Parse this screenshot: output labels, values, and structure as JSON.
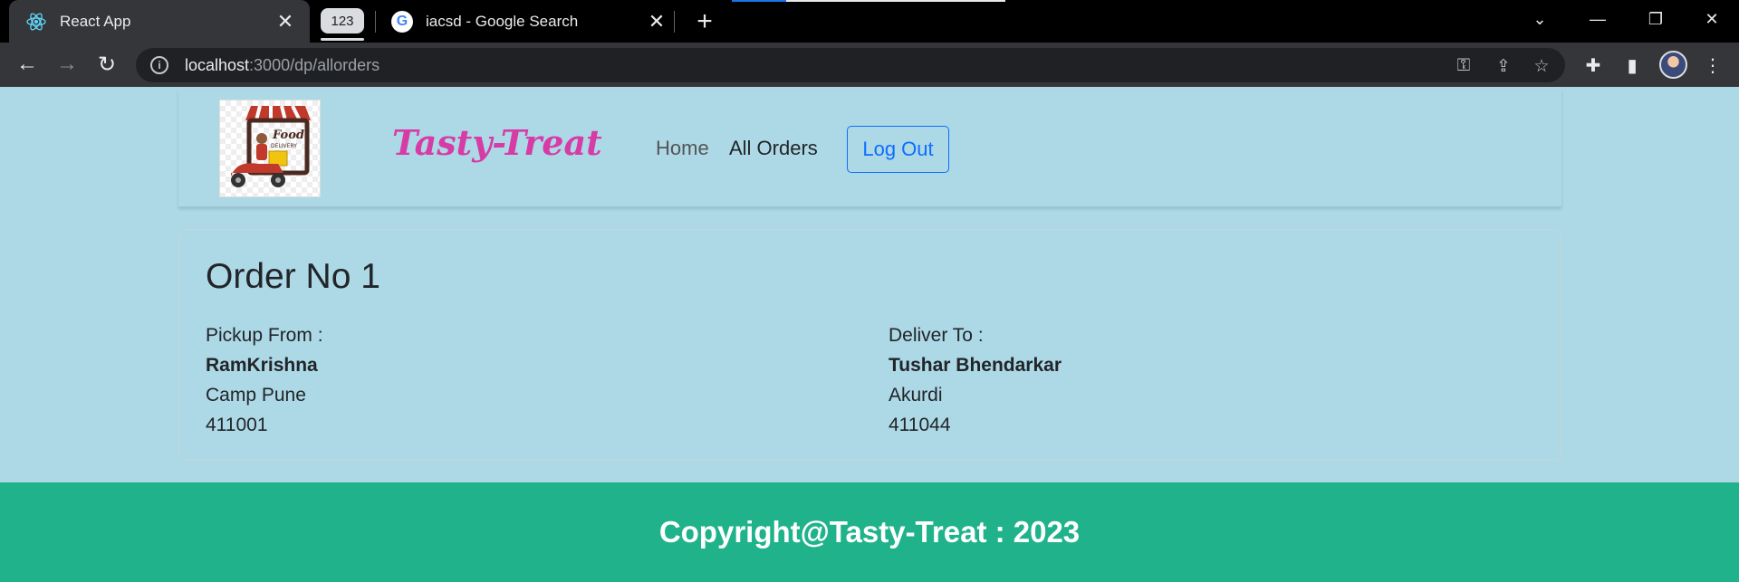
{
  "browser": {
    "tabs": [
      {
        "title": "React App",
        "favicon": "react-icon",
        "active": true
      },
      {
        "title": "iacsd - Google Search",
        "favicon": "google-icon",
        "active": false
      }
    ],
    "tab_group_label": "123",
    "url_host": "localhost",
    "url_path": ":3000/dp/allorders"
  },
  "navbar": {
    "brand": "Tasty-Treat",
    "links": [
      {
        "label": "Home"
      },
      {
        "label": "All Orders"
      }
    ],
    "logout_label": "Log Out",
    "brand_color": "#d63ba6",
    "accent_color": "#0d6efd"
  },
  "order": {
    "title": "Order No 1",
    "pickup": {
      "label": "Pickup From :",
      "name": "RamKrishna",
      "area": "Camp Pune",
      "pincode": "411001"
    },
    "delivery": {
      "label": "Deliver To :",
      "name": "Tushar Bhendarkar",
      "area": "Akurdi",
      "pincode": "411044"
    }
  },
  "footer": {
    "text": "Copyright@Tasty-Treat : 2023",
    "background": "#20b38b"
  },
  "colors": {
    "page_background": "#add8e6"
  }
}
